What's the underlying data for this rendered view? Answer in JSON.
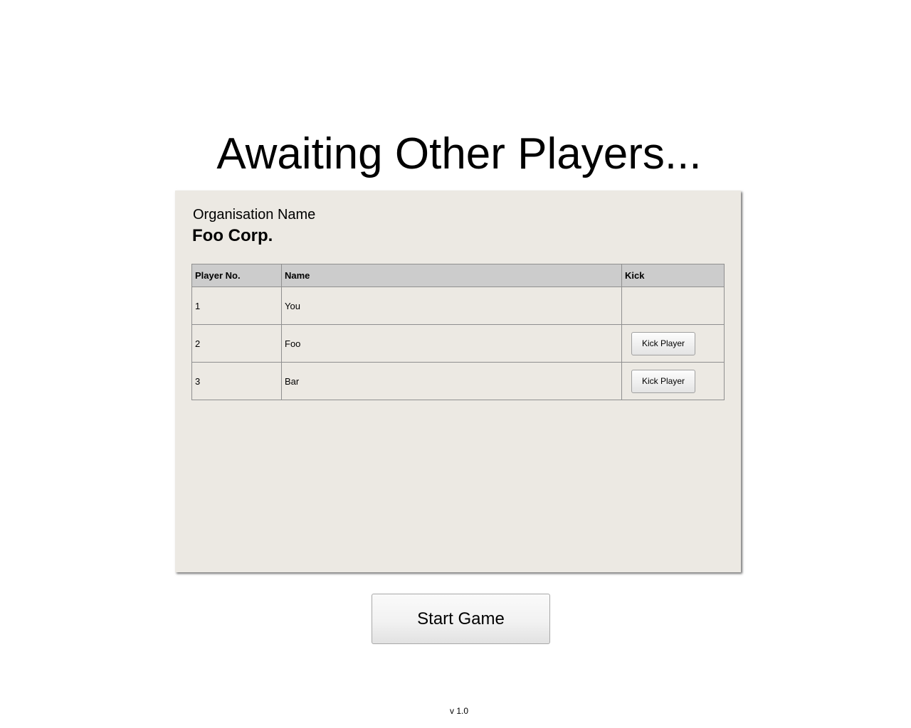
{
  "title": "Awaiting Other Players...",
  "organisation": {
    "label": "Organisation Name",
    "name": "Foo Corp."
  },
  "table": {
    "headers": {
      "player_no": "Player No.",
      "name": "Name",
      "kick": "Kick"
    },
    "rows": [
      {
        "player_no": "1",
        "name": "You",
        "kick_label": ""
      },
      {
        "player_no": "2",
        "name": "Foo",
        "kick_label": "Kick Player"
      },
      {
        "player_no": "3",
        "name": "Bar",
        "kick_label": "Kick Player"
      }
    ]
  },
  "start_button": "Start Game",
  "version": "v 1.0",
  "colors": {
    "panel_background": "#ece9e3",
    "table_header_background": "#cccccc",
    "page_background": "#ffffff"
  }
}
